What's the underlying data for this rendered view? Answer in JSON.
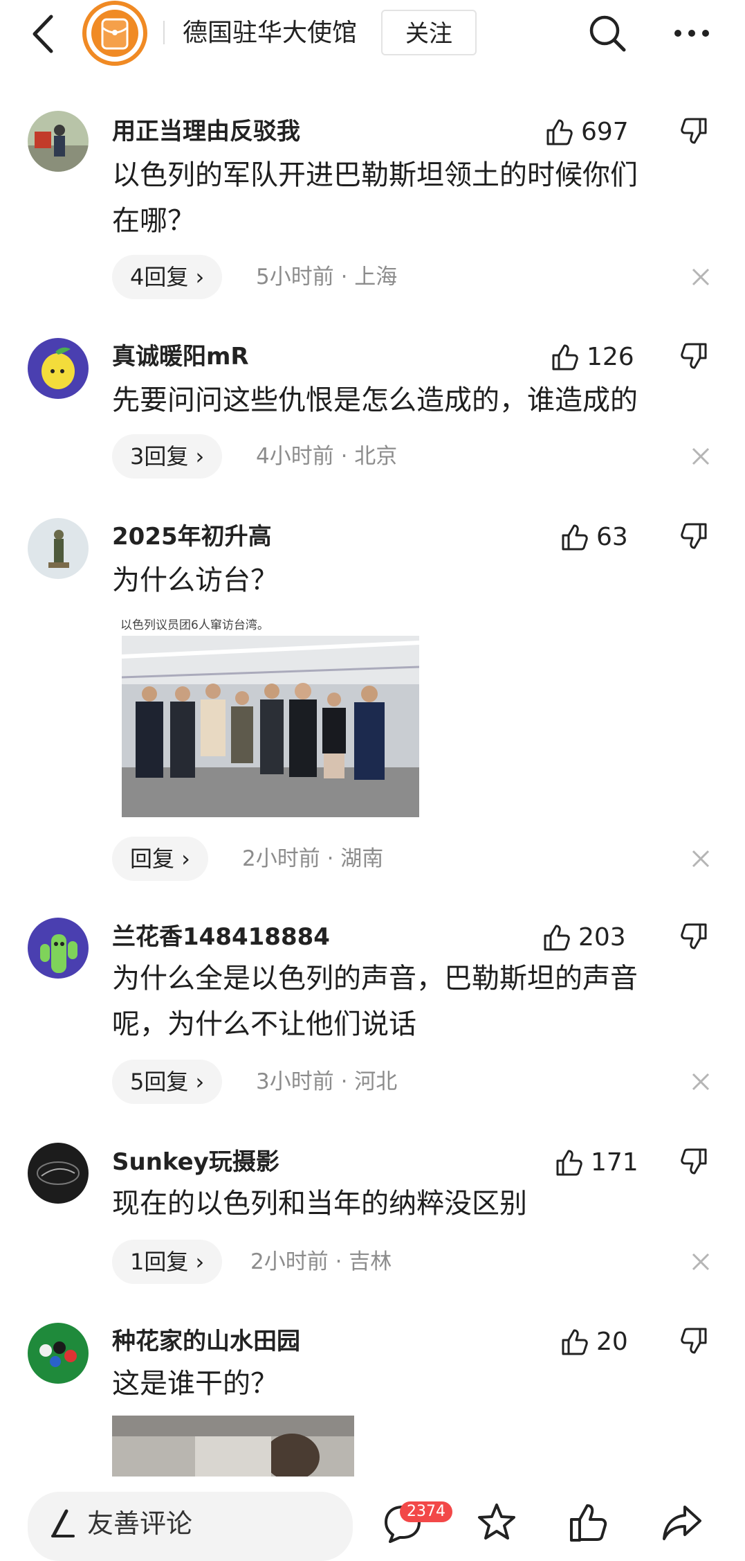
{
  "header": {
    "account_name": "德国驻华大使馆",
    "follow_label": "关注"
  },
  "comments": [
    {
      "user": "用正当理由反驳我",
      "likes": "697",
      "lines": [
        "以色列的军队开进巴勒斯坦领土的时候你们",
        "在哪？"
      ],
      "reply": "4回复 ›",
      "time": "5小时前 · 上海"
    },
    {
      "user": "真诚暖阳mR",
      "likes": "126",
      "lines": [
        "先要问问这些仇恨是怎么造成的，谁造成的"
      ],
      "reply": "3回复 ›",
      "time": "4小时前 · 北京"
    },
    {
      "user": "2025年初升高",
      "likes": "63",
      "lines": [
        "为什么访台？"
      ],
      "image_caption": "以色列议员团6人窜访台湾。",
      "reply": "回复 ›",
      "time": "2小时前 · 湖南"
    },
    {
      "user": "兰花香148418884",
      "likes": "203",
      "lines": [
        "为什么全是以色列的声音，巴勒斯坦的声音",
        "呢，为什么不让他们说话"
      ],
      "reply": "5回复 ›",
      "time": "3小时前 · 河北"
    },
    {
      "user": "Sunkey玩摄影",
      "likes": "171",
      "lines": [
        "现在的以色列和当年的纳粹没区别"
      ],
      "reply": "1回复 ›",
      "time": "2小时前 · 吉林"
    },
    {
      "user": "种花家的山水田园",
      "likes": "20",
      "lines": [
        "这是谁干的？"
      ]
    }
  ],
  "bottom": {
    "comment_placeholder": "友善评论",
    "comment_count": "2374"
  },
  "colors": {
    "logo_orange": "#f08a24",
    "badge_red": "#f24848"
  }
}
